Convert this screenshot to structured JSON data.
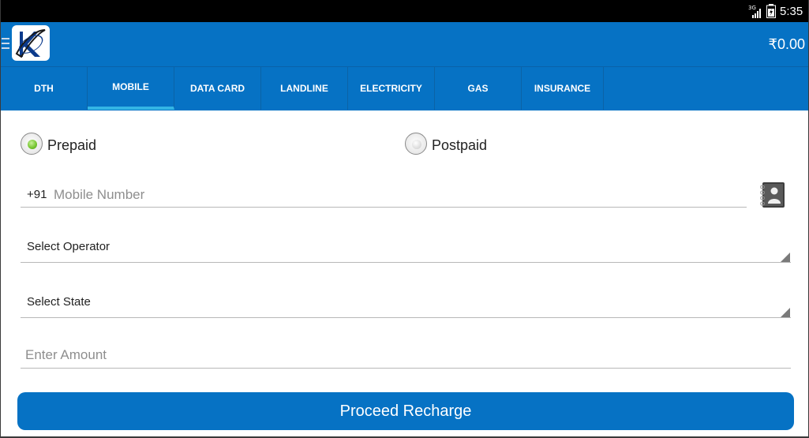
{
  "status_bar": {
    "time": "5:35",
    "network": "3G"
  },
  "header": {
    "balance": "₹0.00"
  },
  "tabs": [
    {
      "label": "DTH"
    },
    {
      "label": "MOBILE"
    },
    {
      "label": "DATA CARD"
    },
    {
      "label": "LANDLINE"
    },
    {
      "label": "ELECTRICITY"
    },
    {
      "label": "GAS"
    },
    {
      "label": "INSURANCE"
    }
  ],
  "active_tab": "MOBILE",
  "form": {
    "prepaid_label": "Prepaid",
    "postpaid_label": "Postpaid",
    "selected_plan": "Prepaid",
    "country_code": "+91",
    "mobile_placeholder": "Mobile Number",
    "operator_label": "Select Operator",
    "state_label": "Select State",
    "amount_placeholder": "Enter Amount",
    "proceed_label": "Proceed Recharge"
  },
  "colors": {
    "primary": "#0672c4",
    "tab_indicator": "#33b5e5",
    "radio_selected": "#79c834"
  }
}
